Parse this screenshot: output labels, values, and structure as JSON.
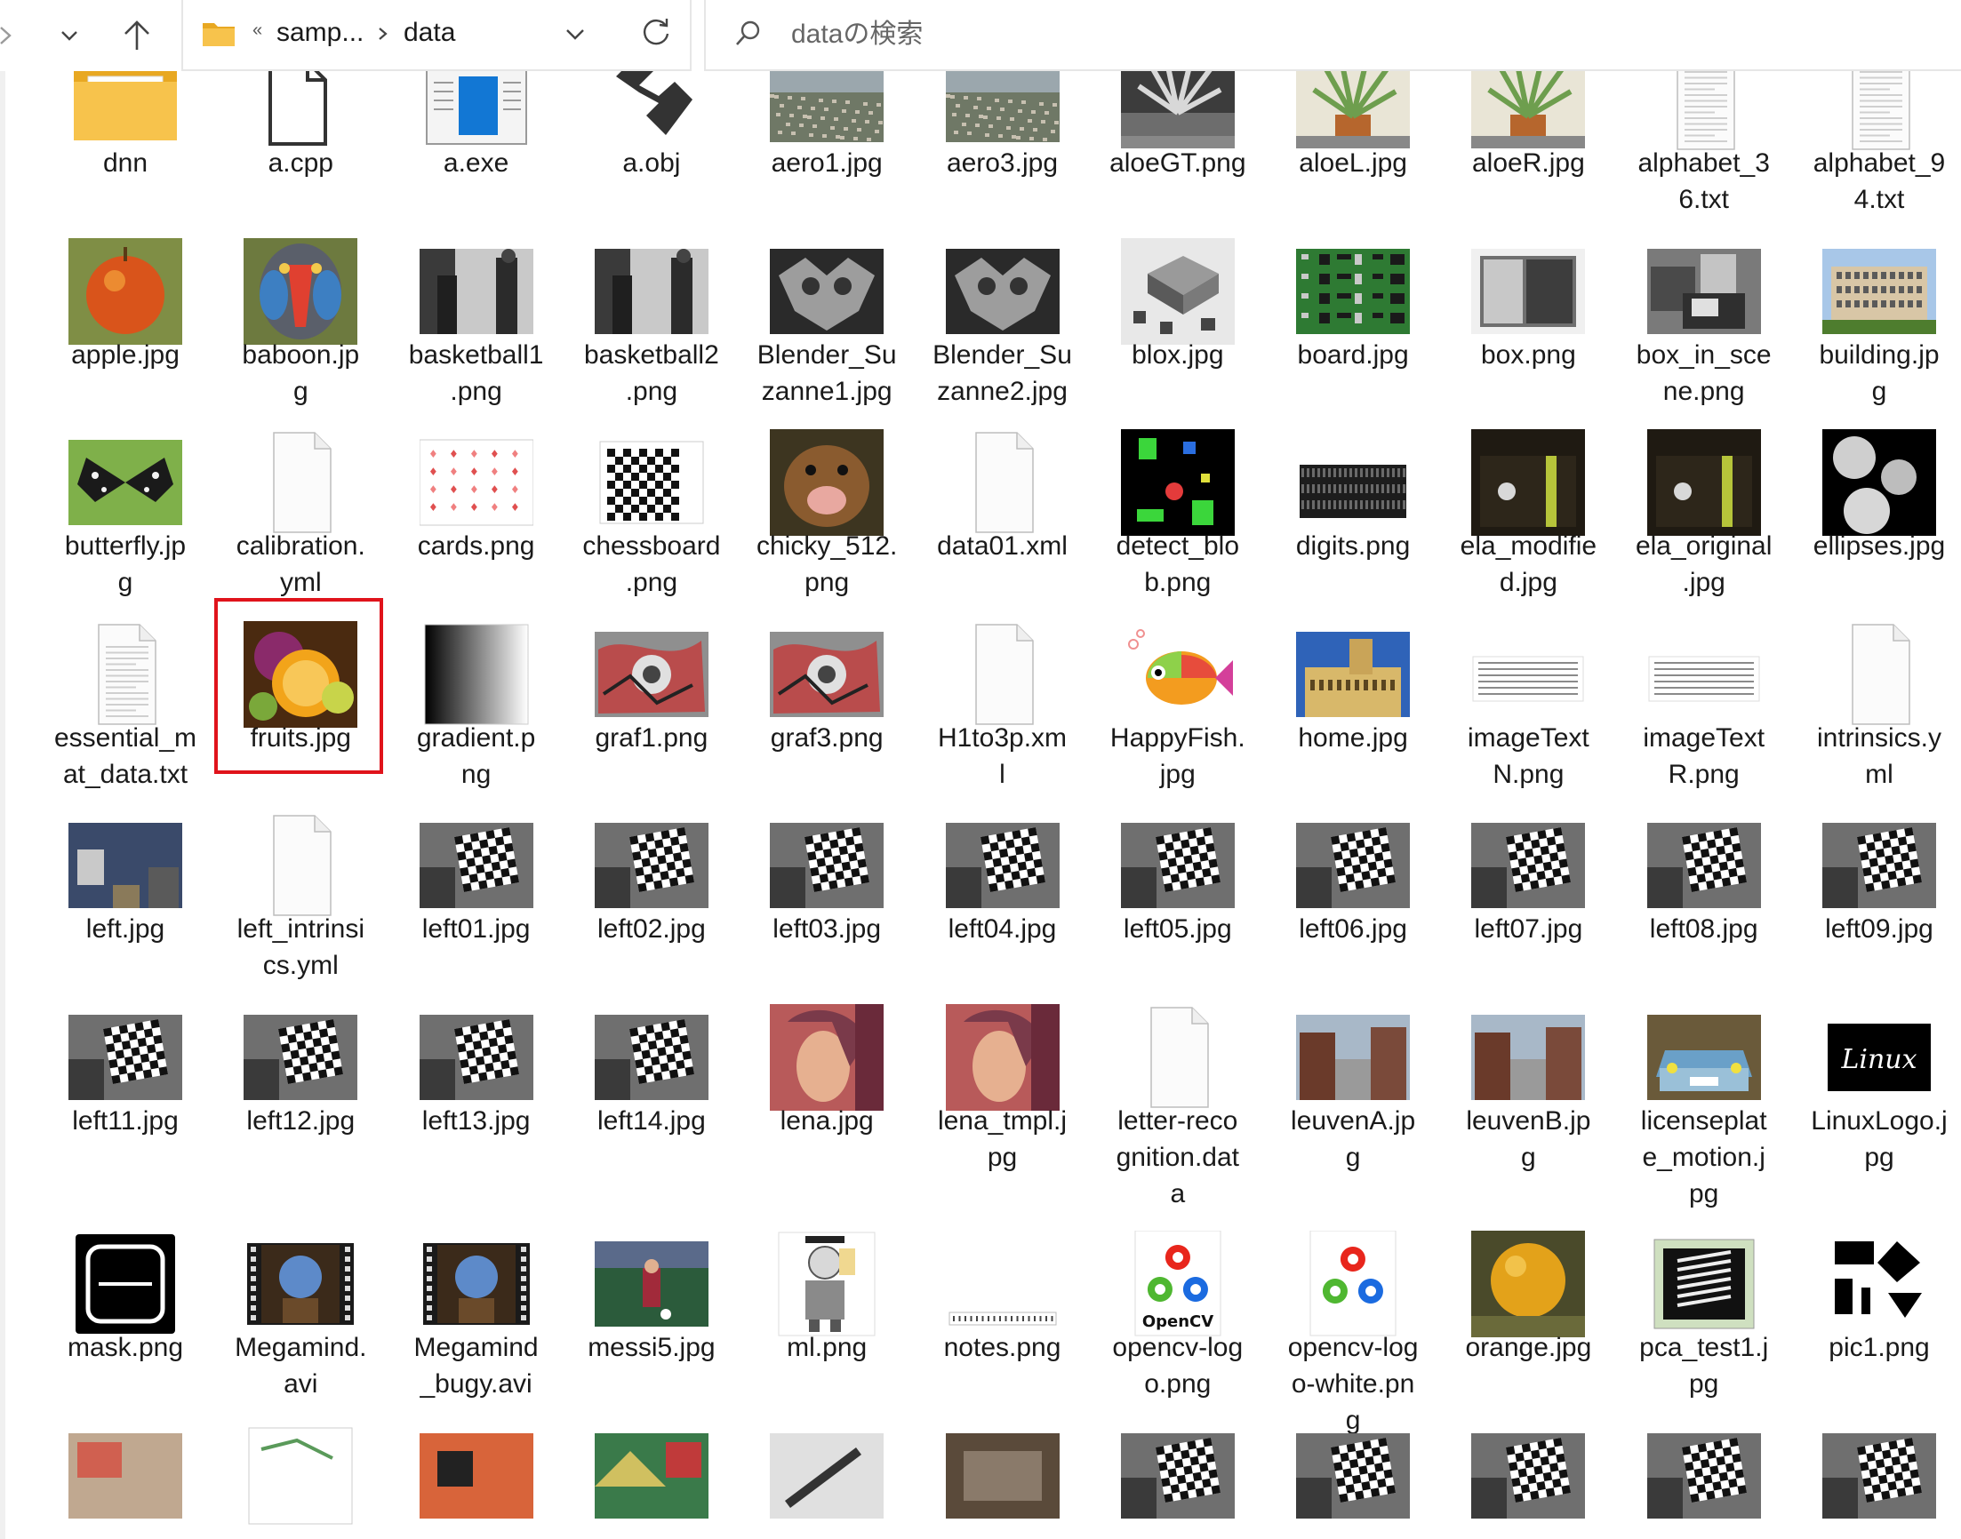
{
  "toolbar": {
    "breadcrumb": [
      "samp...",
      "data"
    ],
    "search_placeholder": "dataの検索"
  },
  "colors": {
    "selection": "#e0131b",
    "folder": "#f7c34c",
    "accent": "#0f6cbd"
  },
  "files": [
    {
      "label": "dnn",
      "thumb": "folder"
    },
    {
      "label": "a.cpp",
      "thumb": "cpp"
    },
    {
      "label": "a.exe",
      "thumb": "exe"
    },
    {
      "label": "a.obj",
      "thumb": "obj"
    },
    {
      "label": "aero1.jpg",
      "thumb": "aerial"
    },
    {
      "label": "aero3.jpg",
      "thumb": "aerial"
    },
    {
      "label": "aloeGT.png",
      "thumb": "aloe-gray"
    },
    {
      "label": "aloeL.jpg",
      "thumb": "aloe"
    },
    {
      "label": "aloeR.jpg",
      "thumb": "aloe"
    },
    {
      "label": "alphabet_3\n6.txt",
      "thumb": "textdoc"
    },
    {
      "label": "alphabet_9\n4.txt",
      "thumb": "textdoc"
    },
    {
      "label": "apple.jpg",
      "thumb": "apple"
    },
    {
      "label": "baboon.jp\ng",
      "thumb": "baboon"
    },
    {
      "label": "basketball1\n.png",
      "thumb": "basketball"
    },
    {
      "label": "basketball2\n.png",
      "thumb": "basketball"
    },
    {
      "label": "Blender_Su\nzanne1.jpg",
      "thumb": "suzanne"
    },
    {
      "label": "Blender_Su\nzanne2.jpg",
      "thumb": "suzanne"
    },
    {
      "label": "blox.jpg",
      "thumb": "blox"
    },
    {
      "label": "board.jpg",
      "thumb": "board"
    },
    {
      "label": "box.png",
      "thumb": "box"
    },
    {
      "label": "box_in_sce\nne.png",
      "thumb": "boxscene"
    },
    {
      "label": "building.jp\ng",
      "thumb": "building"
    },
    {
      "label": "butterfly.jp\ng",
      "thumb": "butterfly"
    },
    {
      "label": "calibration.\nyml",
      "thumb": "blank"
    },
    {
      "label": "cards.png",
      "thumb": "cards"
    },
    {
      "label": "chessboard\n.png",
      "thumb": "chessboard"
    },
    {
      "label": "chicky_512.\npng",
      "thumb": "dog"
    },
    {
      "label": "data01.xml",
      "thumb": "blank"
    },
    {
      "label": "detect_blo\nb.png",
      "thumb": "detect"
    },
    {
      "label": "digits.png",
      "thumb": "digits"
    },
    {
      "label": "ela_modifie\nd.jpg",
      "thumb": "ela"
    },
    {
      "label": "ela_original\n.jpg",
      "thumb": "ela"
    },
    {
      "label": "ellipses.jpg",
      "thumb": "ellipses"
    },
    {
      "label": "essential_m\nat_data.txt",
      "thumb": "textdoc"
    },
    {
      "label": "fruits.jpg",
      "thumb": "fruits"
    },
    {
      "label": "gradient.p\nng",
      "thumb": "gradient"
    },
    {
      "label": "graf1.png",
      "thumb": "graf"
    },
    {
      "label": "graf3.png",
      "thumb": "graf"
    },
    {
      "label": "H1to3p.xm\nl",
      "thumb": "blank"
    },
    {
      "label": "HappyFish.\njpg",
      "thumb": "fish"
    },
    {
      "label": "home.jpg",
      "thumb": "home"
    },
    {
      "label": "imageText\nN.png",
      "thumb": "textimg"
    },
    {
      "label": "imageText\nR.png",
      "thumb": "textimg"
    },
    {
      "label": "intrinsics.y\nml",
      "thumb": "blank"
    },
    {
      "label": "left.jpg",
      "thumb": "leftroom"
    },
    {
      "label": "left_intrinsi\ncs.yml",
      "thumb": "blank"
    },
    {
      "label": "left01.jpg",
      "thumb": "calib"
    },
    {
      "label": "left02.jpg",
      "thumb": "calib"
    },
    {
      "label": "left03.jpg",
      "thumb": "calib"
    },
    {
      "label": "left04.jpg",
      "thumb": "calib"
    },
    {
      "label": "left05.jpg",
      "thumb": "calib"
    },
    {
      "label": "left06.jpg",
      "thumb": "calib"
    },
    {
      "label": "left07.jpg",
      "thumb": "calib"
    },
    {
      "label": "left08.jpg",
      "thumb": "calib"
    },
    {
      "label": "left09.jpg",
      "thumb": "calib"
    },
    {
      "label": "left11.jpg",
      "thumb": "calib"
    },
    {
      "label": "left12.jpg",
      "thumb": "calib"
    },
    {
      "label": "left13.jpg",
      "thumb": "calib"
    },
    {
      "label": "left14.jpg",
      "thumb": "calib"
    },
    {
      "label": "lena.jpg",
      "thumb": "lena"
    },
    {
      "label": "lena_tmpl.j\npg",
      "thumb": "lena"
    },
    {
      "label": "letter-reco\ngnition.dat\na",
      "thumb": "blank"
    },
    {
      "label": "leuvenA.jp\ng",
      "thumb": "leuven"
    },
    {
      "label": "leuvenB.jp\ng",
      "thumb": "leuven"
    },
    {
      "label": "licenseplat\ne_motion.j\npg",
      "thumb": "car"
    },
    {
      "label": "LinuxLogo.j\npg",
      "thumb": "linux"
    },
    {
      "label": "mask.png",
      "thumb": "mask"
    },
    {
      "label": "Megamind.\navi",
      "thumb": "video"
    },
    {
      "label": "Megamind\n_bugy.avi",
      "thumb": "video"
    },
    {
      "label": "messi5.jpg",
      "thumb": "soccer"
    },
    {
      "label": "ml.png",
      "thumb": "ml"
    },
    {
      "label": "notes.png",
      "thumb": "notes"
    },
    {
      "label": "opencv-log\no.png",
      "thumb": "opencv"
    },
    {
      "label": "opencv-log\no-white.pn\ng",
      "thumb": "opencv-white"
    },
    {
      "label": "orange.jpg",
      "thumb": "orange"
    },
    {
      "label": "pca_test1.j\npg",
      "thumb": "pca"
    },
    {
      "label": "pic1.png",
      "thumb": "pic1"
    },
    {
      "label": "",
      "thumb": "misc1"
    },
    {
      "label": "",
      "thumb": "misc2"
    },
    {
      "label": "",
      "thumb": "misc3"
    },
    {
      "label": "",
      "thumb": "misc4"
    },
    {
      "label": "",
      "thumb": "misc5"
    },
    {
      "label": "",
      "thumb": "misc6"
    },
    {
      "label": "",
      "thumb": "calib"
    },
    {
      "label": "",
      "thumb": "calib"
    },
    {
      "label": "",
      "thumb": "calib"
    },
    {
      "label": "",
      "thumb": "calib"
    },
    {
      "label": "",
      "thumb": "calib"
    }
  ],
  "selected_index": 34,
  "opencv_logo_text": "OpenCV",
  "linux_logo_text": "Linux"
}
